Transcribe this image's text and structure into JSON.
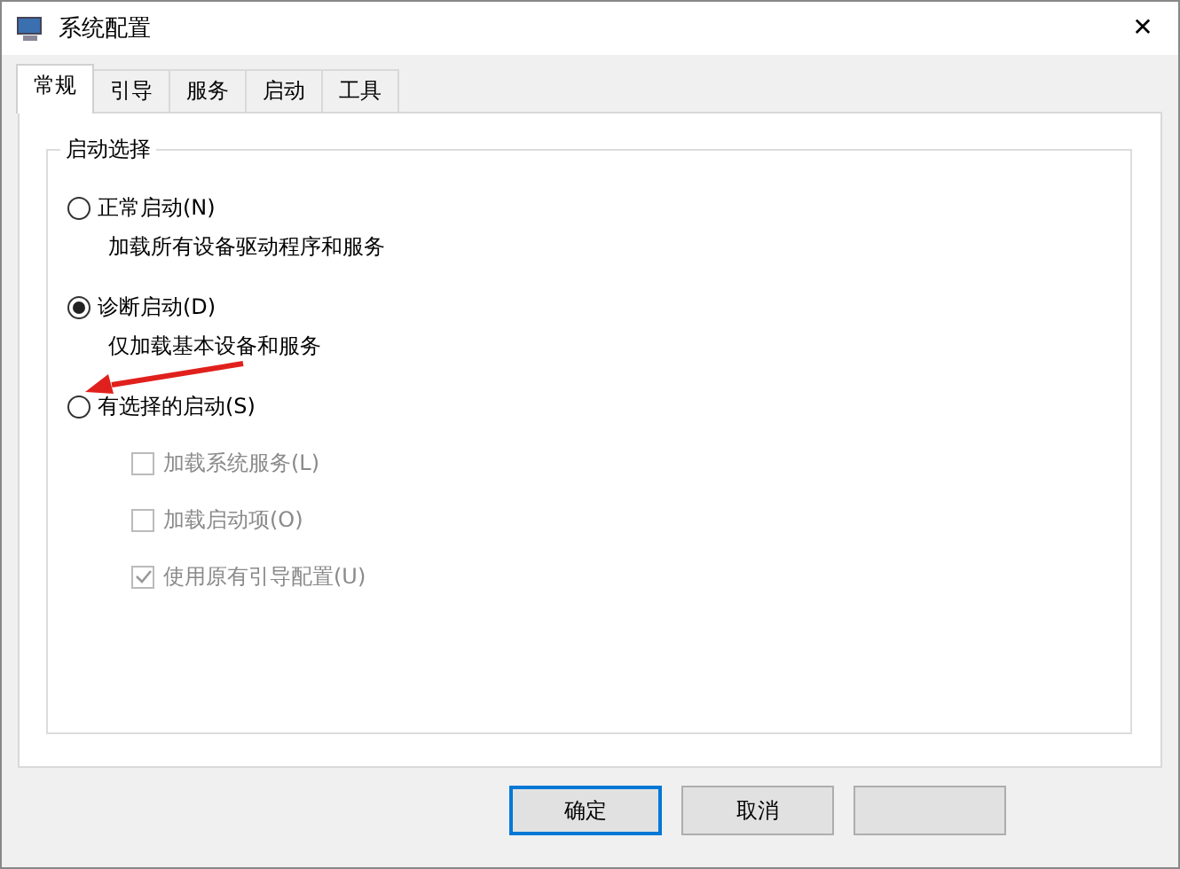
{
  "window": {
    "title": "系统配置",
    "close": "✕"
  },
  "tabs": [
    {
      "label": "常规",
      "selected": true
    },
    {
      "label": "引导",
      "selected": false
    },
    {
      "label": "服务",
      "selected": false
    },
    {
      "label": "启动",
      "selected": false
    },
    {
      "label": "工具",
      "selected": false
    }
  ],
  "group": {
    "title": "启动选择",
    "options": [
      {
        "label": "正常启动(N)",
        "selected": false,
        "description": "加载所有设备驱动程序和服务"
      },
      {
        "label": "诊断启动(D)",
        "selected": true,
        "description": "仅加载基本设备和服务"
      },
      {
        "label": "有选择的启动(S)",
        "selected": false,
        "checkboxes": [
          {
            "label": "加载系统服务(L)",
            "checked": false,
            "disabled": true
          },
          {
            "label": "加载启动项(O)",
            "checked": false,
            "disabled": true
          },
          {
            "label": "使用原有引导配置(U)",
            "checked": true,
            "disabled": true
          }
        ]
      }
    ]
  },
  "annotation": {
    "kind": "arrow",
    "color": "#e0201c"
  },
  "buttons": [
    {
      "label": "确定",
      "default": true
    },
    {
      "label": "取消",
      "default": false
    },
    {
      "default": false
    }
  ]
}
